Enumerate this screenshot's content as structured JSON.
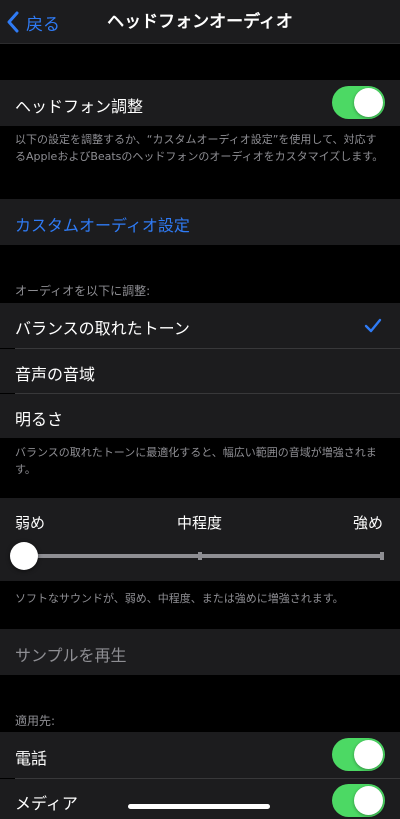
{
  "nav": {
    "back_label": "戻る",
    "title": "ヘッドフォンオーディオ"
  },
  "headphone_adjust": {
    "label": "ヘッドフォン調整",
    "enabled": true,
    "footer": "以下の設定を調整するか、“カスタムオーディオ設定”を使用して、対応するAppleおよびBeatsのヘッドフォンのオーディオをカスタマイズします。"
  },
  "custom_audio": {
    "label": "カスタムオーディオ設定"
  },
  "tune": {
    "header": "オーディオを以下に調整:",
    "options": [
      {
        "label": "バランスの取れたトーン",
        "selected": true
      },
      {
        "label": "音声の音域",
        "selected": false
      },
      {
        "label": "明るさ",
        "selected": false
      }
    ],
    "footer": "バランスの取れたトーンに最適化すると、幅広い範囲の音域が増強されます。"
  },
  "strength": {
    "low_label": "弱め",
    "mid_label": "中程度",
    "high_label": "強め",
    "level_fraction": 0.0,
    "footer": "ソフトなサウンドが、弱め、中程度、または強めに増強されます。"
  },
  "sample": {
    "label": "サンプルを再生"
  },
  "apply": {
    "header": "適用先:",
    "items": [
      {
        "label": "電話",
        "enabled": true
      },
      {
        "label": "メディア",
        "enabled": true
      }
    ]
  },
  "colors": {
    "accent": "#2f7bf5",
    "toggle_on": "#4cd964",
    "cell_bg": "#1c1c1e",
    "secondary_text": "#8e8e93"
  }
}
